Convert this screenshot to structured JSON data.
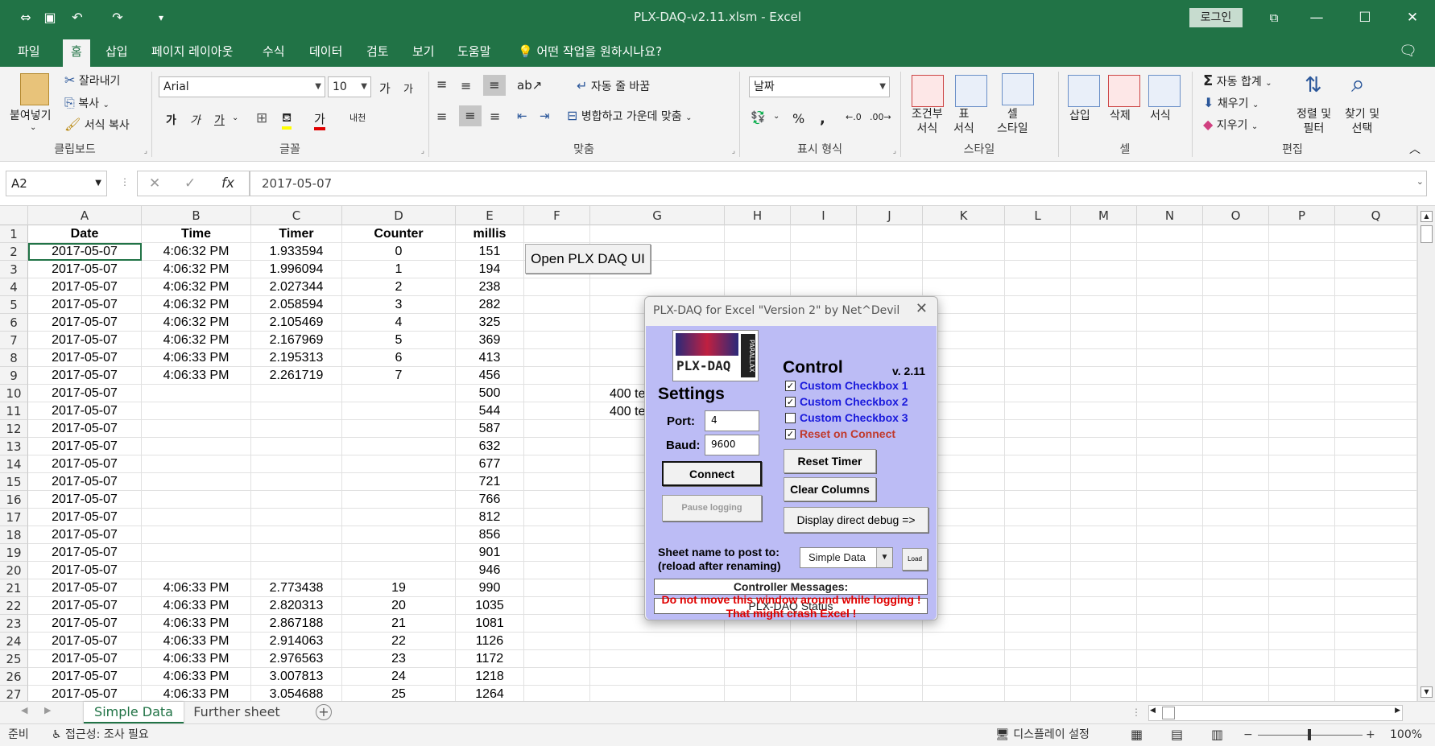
{
  "window": {
    "title": "PLX-DAQ-v2.11.xlsm  -  Excel",
    "login": "로그인"
  },
  "quick_access": {
    "autosave_icon": "autosave-icon",
    "save_icon": "save-icon",
    "undo_icon": "undo-icon",
    "redo_icon": "redo-icon",
    "customize_icon": "customize-icon"
  },
  "menu": {
    "tabs": [
      "파일",
      "홈",
      "삽입",
      "페이지 레이아웃",
      "수식",
      "데이터",
      "검토",
      "보기",
      "도움말"
    ],
    "active": "홈",
    "tell_me": "어떤 작업을 원하시나요?"
  },
  "ribbon": {
    "clipboard": {
      "label": "클립보드",
      "paste": "붙여넣기",
      "cut": "잘라내기",
      "copy": "복사",
      "format_painter": "서식 복사"
    },
    "font": {
      "label": "글꼴",
      "font_name": "Arial",
      "font_size": "10",
      "bold": "가",
      "italic": "가",
      "underline": "가",
      "grow": "가",
      "shrink": "가",
      "phonetic": "내천"
    },
    "alignment": {
      "label": "맞춤",
      "wrap_text": "자동 줄 바꿈",
      "merge_center": "병합하고 가운데 맞춤"
    },
    "number": {
      "label": "표시 형식",
      "format": "날짜",
      "percent": "%",
      "comma": ","
    },
    "styles": {
      "label": "스타일",
      "conditional": [
        "조건부",
        "서식"
      ],
      "format_table": [
        "표",
        "서식"
      ],
      "cell_styles": [
        "셀",
        "스타일"
      ]
    },
    "cells": {
      "label": "셀",
      "insert": "삽입",
      "delete": "삭제",
      "format": "서식"
    },
    "editing": {
      "label": "편집",
      "autosum": "자동 합계",
      "fill": "채우기",
      "clear": "지우기",
      "sort_filter": [
        "정렬 및",
        "필터"
      ],
      "find_select": [
        "찾기 및",
        "선택"
      ]
    }
  },
  "formula_bar": {
    "name_box": "A2",
    "formula": "2017-05-07",
    "fx": "fx"
  },
  "columns": [
    "A",
    "B",
    "C",
    "D",
    "E",
    "F",
    "G",
    "H",
    "I",
    "J",
    "K",
    "L",
    "M",
    "N",
    "O",
    "P",
    "Q"
  ],
  "headers": [
    "Date",
    "Time",
    "Timer",
    "Counter",
    "millis"
  ],
  "rows": [
    [
      "2",
      "2017-05-07",
      "4:06:32 PM",
      "1.933594",
      "0",
      "151"
    ],
    [
      "3",
      "2017-05-07",
      "4:06:32 PM",
      "1.996094",
      "1",
      "194"
    ],
    [
      "4",
      "2017-05-07",
      "4:06:32 PM",
      "2.027344",
      "2",
      "238"
    ],
    [
      "5",
      "2017-05-07",
      "4:06:32 PM",
      "2.058594",
      "3",
      "282"
    ],
    [
      "6",
      "2017-05-07",
      "4:06:32 PM",
      "2.105469",
      "4",
      "325"
    ],
    [
      "7",
      "2017-05-07",
      "4:06:32 PM",
      "2.167969",
      "5",
      "369"
    ],
    [
      "8",
      "2017-05-07",
      "4:06:33 PM",
      "2.195313",
      "6",
      "413"
    ],
    [
      "9",
      "2017-05-07",
      "4:06:33 PM",
      "2.261719",
      "7",
      "456"
    ],
    [
      "10",
      "2017-05-07",
      "",
      "",
      "",
      "500"
    ],
    [
      "11",
      "2017-05-07",
      "",
      "",
      "",
      "544"
    ],
    [
      "12",
      "2017-05-07",
      "",
      "",
      "",
      "587"
    ],
    [
      "13",
      "2017-05-07",
      "",
      "",
      "",
      "632"
    ],
    [
      "14",
      "2017-05-07",
      "",
      "",
      "",
      "677"
    ],
    [
      "15",
      "2017-05-07",
      "",
      "",
      "",
      "721"
    ],
    [
      "16",
      "2017-05-07",
      "",
      "",
      "",
      "766"
    ],
    [
      "17",
      "2017-05-07",
      "",
      "",
      "",
      "812"
    ],
    [
      "18",
      "2017-05-07",
      "",
      "",
      "",
      "856"
    ],
    [
      "19",
      "2017-05-07",
      "",
      "",
      "",
      "901"
    ],
    [
      "20",
      "2017-05-07",
      "",
      "",
      "",
      "946"
    ],
    [
      "21",
      "2017-05-07",
      "4:06:33 PM",
      "2.773438",
      "19",
      "990"
    ],
    [
      "22",
      "2017-05-07",
      "4:06:33 PM",
      "2.820313",
      "20",
      "1035"
    ],
    [
      "23",
      "2017-05-07",
      "4:06:33 PM",
      "2.867188",
      "21",
      "1081"
    ],
    [
      "24",
      "2017-05-07",
      "4:06:33 PM",
      "2.914063",
      "22",
      "1126"
    ],
    [
      "25",
      "2017-05-07",
      "4:06:33 PM",
      "2.976563",
      "23",
      "1172"
    ],
    [
      "26",
      "2017-05-07",
      "4:06:33 PM",
      "3.007813",
      "24",
      "1218"
    ],
    [
      "27",
      "2017-05-07",
      "4:06:33 PM",
      "3.054688",
      "25",
      "1264"
    ]
  ],
  "overflow_text": {
    "row10": "400 te",
    "row11": "400 te"
  },
  "open_button": "Open PLX DAQ UI",
  "dialog": {
    "title": "PLX-DAQ for Excel \"Version 2\" by Net^Devil",
    "logo_text": "PLX-DAQ",
    "logo_side": "PARALLAX",
    "settings": "Settings",
    "port_label": "Port:",
    "port_value": "4",
    "baud_label": "Baud:",
    "baud_value": "9600",
    "connect": "Connect",
    "pause": "Pause logging",
    "control": "Control",
    "version": "v. 2.11",
    "checkboxes": [
      {
        "label": "Custom Checkbox 1",
        "checked": "✓"
      },
      {
        "label": "Custom Checkbox 2",
        "checked": "✓"
      },
      {
        "label": "Custom Checkbox 3",
        "checked": ""
      },
      {
        "label": "Reset on Connect",
        "checked": "✓"
      }
    ],
    "reset_timer": "Reset Timer",
    "clear_columns": "Clear Columns",
    "display_debug": "Display direct debug =>",
    "sheet_label1": "Sheet name to post to:",
    "sheet_label2": "(reload after renaming)",
    "sheet_value": "Simple Data",
    "load": "Load",
    "controller_messages": "Controller Messages:",
    "status": "PLX-DAQ Status",
    "warning1": "Do not move this window around while logging !",
    "warning2": "That might crash Excel !",
    "colors": {
      "body": "#bcbcf5",
      "checkbox_label": "#1a1adc",
      "reset_label": "#c0392b",
      "warning": "#e00000"
    }
  },
  "sheets": [
    "Simple Data",
    "Further sheet"
  ],
  "statusbar": {
    "ready": "준비",
    "accessibility": "접근성: 조사 필요",
    "display_settings": "디스플레이 설정",
    "zoom": "100%"
  },
  "colors": {
    "excel_green": "#217346"
  }
}
